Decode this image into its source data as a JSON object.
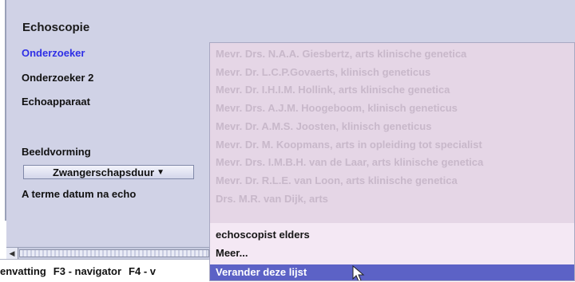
{
  "section": {
    "title": "Echoscopie",
    "fields": {
      "onderzoeker": "Onderzoeker",
      "onderzoeker2": "Onderzoeker 2",
      "echoapparaat": "Echoapparaat",
      "beeldvorming": "Beeldvorming",
      "dropdown_value": "Zwangerschapsduur",
      "aterme": "A terme datum na echo"
    }
  },
  "popup": {
    "faded_items": [
      "Mevr. Drs. N.A.A. Giesbertz, arts klinische genetica",
      "Mevr. Dr. L.C.P.Govaerts, klinisch geneticus",
      "Mevr. Dr. I.H.I.M. Hollink, arts klinische genetica",
      "Mevr. Drs. A.J.M. Hoogeboom, klinisch geneticus",
      "Mevr. Dr. A.M.S. Joosten, klinisch geneticus",
      "Mevr. Dr. M. Koopmans, arts in opleiding tot specialist",
      "Mevr. Drs. I.M.B.H. van de Laar, arts klinische genetica",
      "Mevr. Dr. R.L.E. van Loon, arts klinische genetica",
      "Drs. M.R. van Dijk, arts"
    ],
    "items": [
      "echoscopist elders",
      "Meer..."
    ],
    "selected": "Verander deze lijst"
  },
  "statusbar": {
    "items": [
      "envatting",
      "F3 - navigator",
      "F4 - v"
    ]
  }
}
